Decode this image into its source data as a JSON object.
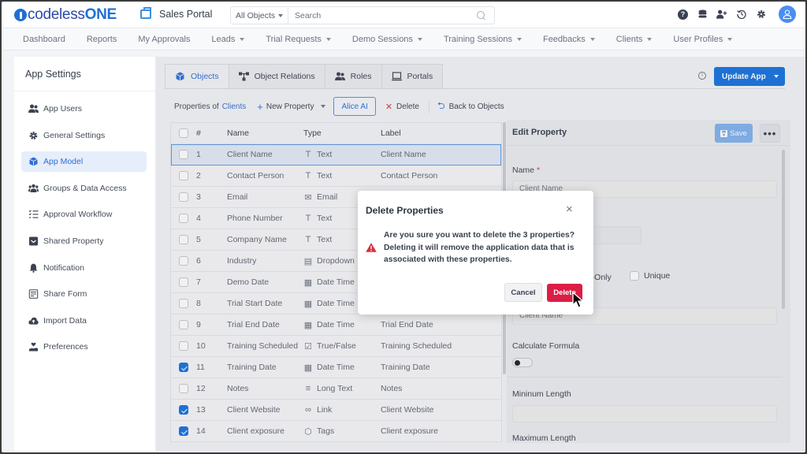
{
  "header": {
    "logo_prefix": "codeless",
    "logo_suffix": "ONE",
    "app_name": "Sales Portal",
    "search_scope": "All Objects",
    "search_placeholder": "Search",
    "icons": [
      "help-icon",
      "database-icon",
      "add-user-icon",
      "history-icon",
      "gear-icon",
      "user-avatar"
    ]
  },
  "nav": [
    {
      "label": "Dashboard",
      "dropdown": false
    },
    {
      "label": "Reports",
      "dropdown": false
    },
    {
      "label": "My Approvals",
      "dropdown": false
    },
    {
      "label": "Leads",
      "dropdown": true
    },
    {
      "label": "Trial Requests",
      "dropdown": true
    },
    {
      "label": "Demo Sessions",
      "dropdown": true
    },
    {
      "label": "Training Sessions",
      "dropdown": true
    },
    {
      "label": "Feedbacks",
      "dropdown": true
    },
    {
      "label": "Clients",
      "dropdown": true
    },
    {
      "label": "User Profiles",
      "dropdown": true
    }
  ],
  "sidebar": {
    "title": "App Settings",
    "items": [
      {
        "label": "App Users",
        "icon": "users-icon"
      },
      {
        "label": "General Settings",
        "icon": "gear-icon"
      },
      {
        "label": "App Model",
        "icon": "cube-icon",
        "active": true
      },
      {
        "label": "Groups & Data Access",
        "icon": "groups-icon"
      },
      {
        "label": "Approval Workflow",
        "icon": "checklist-icon"
      },
      {
        "label": "Shared Property",
        "icon": "inbox-icon"
      },
      {
        "label": "Notification",
        "icon": "bell-icon"
      },
      {
        "label": "Share Form",
        "icon": "form-icon"
      },
      {
        "label": "Import Data",
        "icon": "cloud-upload-icon"
      },
      {
        "label": "Preferences",
        "icon": "hand-heart-icon"
      }
    ]
  },
  "tabs": [
    {
      "label": "Objects",
      "icon": "cube-icon",
      "active": true
    },
    {
      "label": "Object Relations",
      "icon": "relations-icon"
    },
    {
      "label": "Roles",
      "icon": "users-icon"
    },
    {
      "label": "Portals",
      "icon": "laptop-icon"
    }
  ],
  "update_app_label": "Update App",
  "toolbar": {
    "properties_of": "Properties of",
    "object_name": "Clients",
    "new_property": "New Property",
    "alice_ai": "Alice AI",
    "delete": "Delete",
    "back_to_objects": "Back to Objects"
  },
  "table": {
    "columns": [
      "#",
      "Name",
      "Type",
      "Label"
    ],
    "rows": [
      {
        "num": "1",
        "name": "Client Name",
        "type": "Text",
        "type_icon": "T",
        "label": "Client Name",
        "checked": false,
        "selected": true
      },
      {
        "num": "2",
        "name": "Contact Person",
        "type": "Text",
        "type_icon": "T",
        "label": "Contact Person",
        "checked": false
      },
      {
        "num": "3",
        "name": "Email",
        "type": "Email",
        "type_icon": "✉",
        "label": "",
        "checked": false
      },
      {
        "num": "4",
        "name": "Phone Number",
        "type": "Text",
        "type_icon": "T",
        "label": "",
        "checked": false
      },
      {
        "num": "5",
        "name": "Company Name",
        "type": "Text",
        "type_icon": "T",
        "label": "",
        "checked": false
      },
      {
        "num": "6",
        "name": "Industry",
        "type": "Dropdown",
        "type_icon": "▤",
        "label": "",
        "checked": false
      },
      {
        "num": "7",
        "name": "Demo Date",
        "type": "Date Time",
        "type_icon": "▦",
        "label": "",
        "checked": false
      },
      {
        "num": "8",
        "name": "Trial Start Date",
        "type": "Date Time",
        "type_icon": "▦",
        "label": "",
        "checked": false
      },
      {
        "num": "9",
        "name": "Trial End Date",
        "type": "Date Time",
        "type_icon": "▦",
        "label": "Trial End Date",
        "checked": false
      },
      {
        "num": "10",
        "name": "Training Scheduled",
        "type": "True/False",
        "type_icon": "☑",
        "label": "Training Scheduled",
        "checked": false
      },
      {
        "num": "11",
        "name": "Training Date",
        "type": "Date Time",
        "type_icon": "▦",
        "label": "Training Date",
        "checked": true
      },
      {
        "num": "12",
        "name": "Notes",
        "type": "Long Text",
        "type_icon": "≡",
        "label": "Notes",
        "checked": false
      },
      {
        "num": "13",
        "name": "Client Website",
        "type": "Link",
        "type_icon": "∞",
        "label": "Client Website",
        "checked": true
      },
      {
        "num": "14",
        "name": "Client exposure",
        "type": "Tags",
        "type_icon": "⬡",
        "label": "Client exposure",
        "checked": true
      }
    ]
  },
  "edit_panel": {
    "title": "Edit Property",
    "save_label": "Save",
    "more_label": "•••",
    "name_label": "Name",
    "name_required": "*",
    "name_value": "Client Name",
    "read_only_partial": "ad-Only",
    "unique_label": "Unique",
    "label_value": "Client Name",
    "calculate_formula_label": "Calculate Formula",
    "calculate_formula_on": false,
    "min_length_label": "Mininum Length",
    "min_length_value": "",
    "max_length_label": "Maximum Length"
  },
  "modal": {
    "title": "Delete Properties",
    "message": "Are you sure you want to delete the 3 properties? Deleting it will remove the application data that is associated with these properties.",
    "cancel_label": "Cancel",
    "delete_label": "Delete",
    "close_icon": "×"
  }
}
